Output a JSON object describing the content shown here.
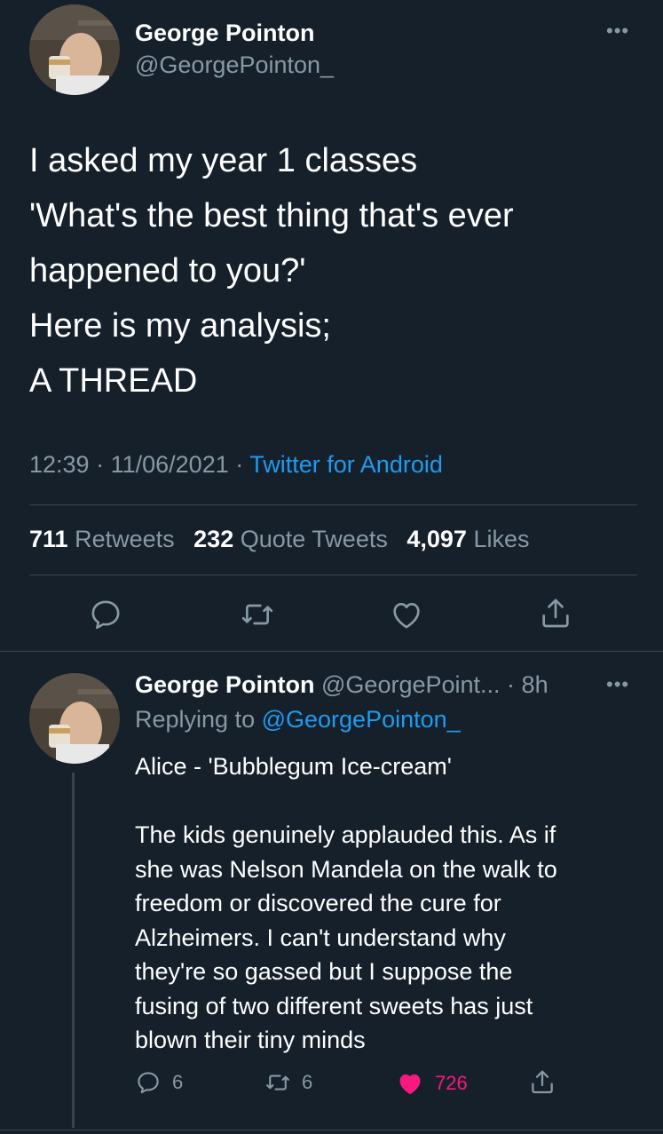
{
  "tweet": {
    "author_name": "George Pointon",
    "author_handle": "@GeorgePointon_",
    "text_lines": [
      "I asked my year 1 classes",
      "'What's the best thing that's ever",
      "happened to you?'",
      "Here is my analysis;",
      "A THREAD"
    ],
    "time": "12:39",
    "date": "11/06/2021",
    "source": "Twitter for Android",
    "retweets": "711",
    "retweets_label": "Retweets",
    "quote_tweets": "232",
    "quote_tweets_label": "Quote Tweets",
    "likes": "4,097",
    "likes_label": "Likes"
  },
  "reply": {
    "author_name": "George Pointon",
    "author_handle": "@GeorgePoint...",
    "age": "8h",
    "replying_to_label": "Replying to",
    "replying_to_handle": "@GeorgePointon_",
    "body_lines": [
      "Alice - 'Bubblegum Ice-cream'",
      "",
      "The kids genuinely applauded this. As if",
      "she was Nelson Mandela on the walk to",
      "freedom or discovered the cure for",
      "Alzheimers. I can't understand why",
      "they're so gassed but I suppose the",
      "fusing of two different sweets has just",
      "blown their tiny minds"
    ],
    "reply_count": "6",
    "retweet_count": "6",
    "like_count": "726",
    "liked": true
  },
  "icons": {
    "more": "more-horizontal-icon",
    "reply": "reply-icon",
    "retweet": "retweet-icon",
    "like": "heart-icon",
    "share": "share-icon"
  },
  "colors": {
    "background": "#15202b",
    "secondary_text": "#8899a6",
    "link": "#1d9bf0",
    "like": "#f91880",
    "divider": "#38444d"
  }
}
